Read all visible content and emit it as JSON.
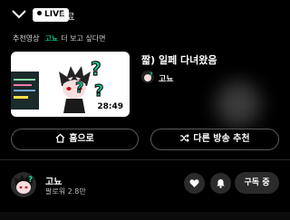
{
  "header": {
    "live_badge": "LIVE",
    "status": "종료"
  },
  "recommendation": {
    "section_title": "추천영상",
    "channel_name": "고뇨",
    "suffix_text": "더 보고 싶다면"
  },
  "video": {
    "duration": "28:49",
    "title": "짧) 일페 다녀왔음",
    "channel_name": "고뇨"
  },
  "buttons": {
    "home": "홈으로",
    "other_stream": "다른 방송 추천"
  },
  "channel": {
    "name": "고뇨",
    "followers": "팔로워 2.8만",
    "subscribe_label": "구독 중"
  },
  "colors": {
    "accent": "#00ffa3",
    "background": "#000000",
    "button_bg": "#2b2b2b"
  }
}
